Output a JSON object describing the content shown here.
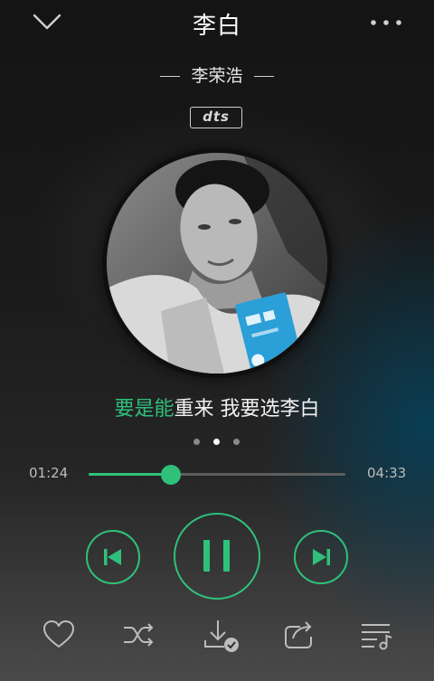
{
  "header": {
    "title": "李白",
    "down_icon": "chevron-down-icon",
    "more_icon": "more-dots-icon"
  },
  "artist": "李荣浩",
  "badge": "dts",
  "lyric": {
    "sung": "要是能",
    "rest": "重来 我要选李白"
  },
  "pager": {
    "count": 3,
    "active": 1
  },
  "progress": {
    "elapsed": "01:24",
    "total": "04:33",
    "fraction": 0.32
  },
  "colors": {
    "accent": "#2fc07a"
  },
  "controls": [
    "previous-icon",
    "pause-icon",
    "next-icon"
  ],
  "actions": [
    "heart-icon",
    "shuffle-icon",
    "download-icon",
    "share-icon",
    "playlist-icon"
  ]
}
